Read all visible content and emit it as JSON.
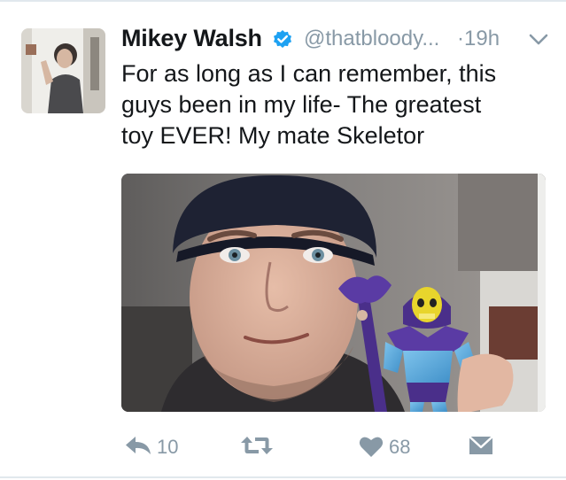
{
  "tweet": {
    "author": {
      "name": "Mikey Walsh",
      "handle": "@thatbloody...",
      "verified": true
    },
    "timestamp": "·19h",
    "text_lines": [
      "For as long as I can remember, this",
      "guys been in my life- The greatest",
      "toy EVER! My mate Skeletor"
    ],
    "media": {
      "kind": "photo",
      "subject": "selfie-holding-skeletor-figure"
    },
    "actions": {
      "reply_count": "10",
      "retweet_count": "",
      "like_count": "68"
    }
  },
  "icons": {
    "verified": "verified-badge-icon",
    "caret": "chevron-down-icon",
    "reply": "reply-arrow-icon",
    "retweet": "retweet-icon",
    "like": "heart-icon",
    "dm": "envelope-icon"
  },
  "colors": {
    "text": "#14171a",
    "secondary": "#8899a6",
    "verified": "#1da1f2",
    "divider": "#e1e8ed"
  }
}
